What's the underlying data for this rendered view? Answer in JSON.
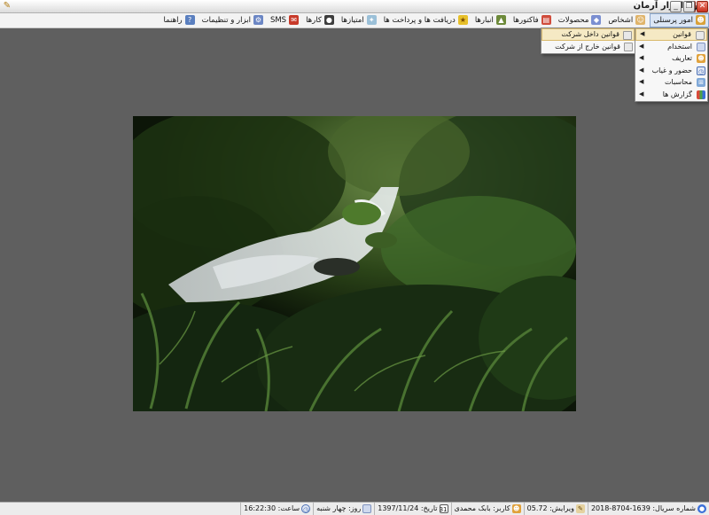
{
  "window": {
    "title": "نرم افزار آرمان"
  },
  "menubar": {
    "items": [
      {
        "label": "امور پرسنلی",
        "icon": "people-icon",
        "active": true
      },
      {
        "label": "اشخاص",
        "icon": "person-icon"
      },
      {
        "label": "محصولات",
        "icon": "products-icon"
      },
      {
        "label": "فاکتورها",
        "icon": "invoice-icon"
      },
      {
        "label": "انبارها",
        "icon": "warehouse-icon"
      },
      {
        "label": "دریافت ها و پرداخت ها",
        "icon": "payment-icon"
      },
      {
        "label": "امتیازها",
        "icon": "star-icon"
      },
      {
        "label": "کارها",
        "icon": "tasks-icon"
      },
      {
        "label": "SMS",
        "icon": "sms-icon"
      },
      {
        "label": "ابزار و تنظیمات",
        "icon": "tools-icon"
      },
      {
        "label": "راهنما",
        "icon": "help-icon"
      }
    ]
  },
  "dropdown": {
    "items": [
      {
        "label": "قوانین",
        "icon": "rules-icon",
        "selected": true
      },
      {
        "label": "استخدام",
        "icon": "hire-icon"
      },
      {
        "label": "تعاریف",
        "icon": "definitions-icon"
      },
      {
        "label": "حضور و غیاب",
        "icon": "clock-icon"
      },
      {
        "label": "محاسبات",
        "icon": "calc-icon"
      },
      {
        "label": "گزارش ها",
        "icon": "report-icon"
      }
    ]
  },
  "submenu": {
    "items": [
      {
        "label": "قوانین داخل شرکت",
        "selected": true
      },
      {
        "label": "قوانین خارج از شرکت"
      }
    ]
  },
  "statusbar": {
    "serial": "شماره سریال: 1639-8704-2018",
    "version": "ویرایش: 05.72",
    "user": "کاربر: بابک محمدی",
    "date": "تاریخ: 1397/11/24",
    "day": "روز: چهار شنبه",
    "time": "ساعت: 16:22:30"
  },
  "colors": {
    "background": "#5f5f5f",
    "menu_highlight": "#f5e9c4"
  }
}
